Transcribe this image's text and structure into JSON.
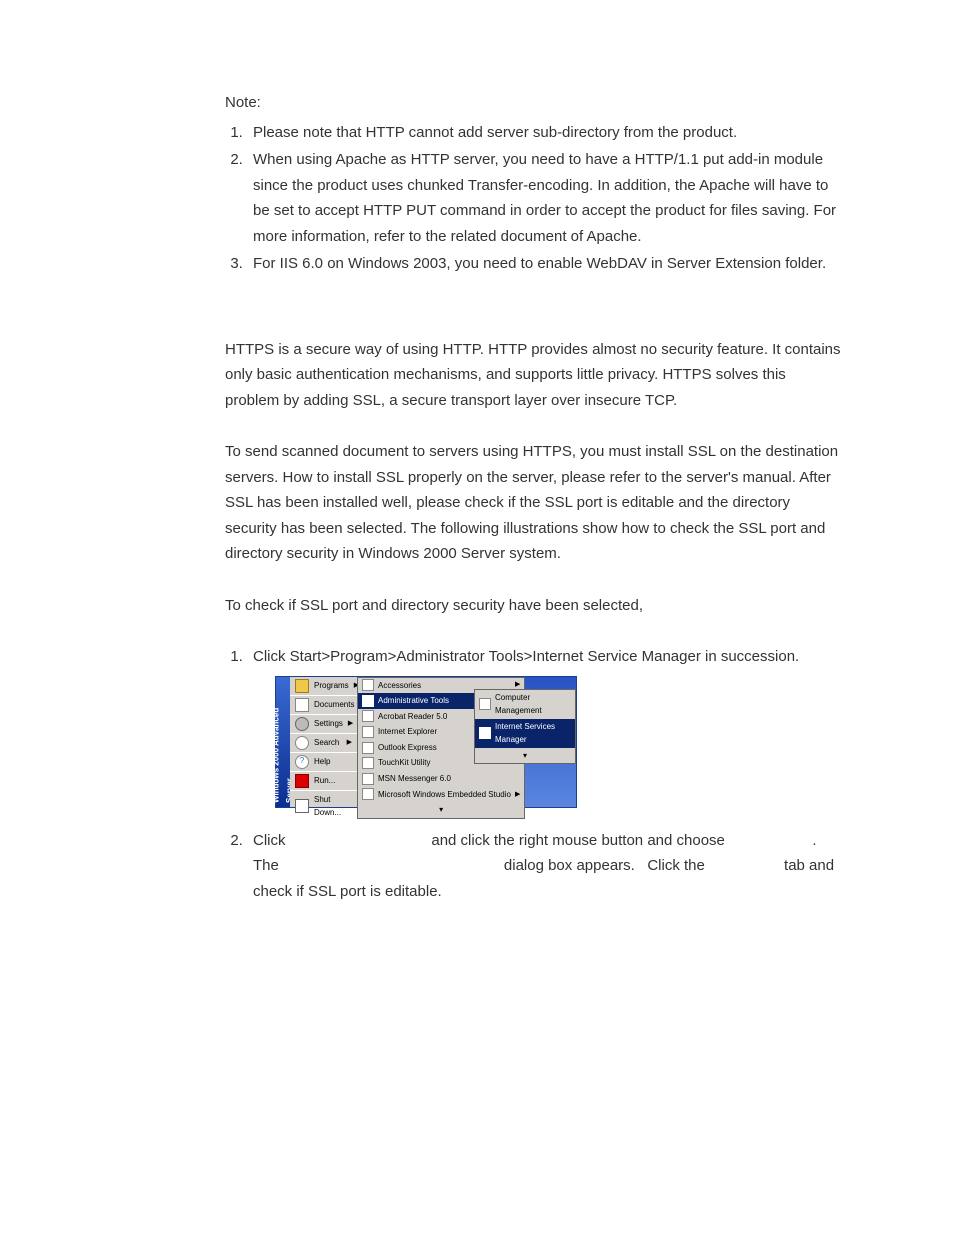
{
  "note": {
    "heading": "Note:",
    "items": [
      "Please note that HTTP cannot add server sub-directory from the product.",
      "When using Apache as HTTP server, you need to have a HTTP/1.1 put add-in module since the product uses chunked Transfer-encoding. In addition, the Apache will have to be set to accept HTTP PUT command in order to accept the product for files saving.   For more information, refer to the related document of Apache.",
      "For IIS 6.0 on Windows 2003, you need to enable WebDAV in Server Extension folder."
    ]
  },
  "para1": "HTTPS is a secure way of using HTTP.   HTTP provides almost no security feature. It contains only basic authentication mechanisms, and supports little privacy. HTTPS solves this problem by adding SSL, a secure transport layer over insecure TCP.",
  "para2": "To send scanned document to servers using HTTPS, you must install SSL on the destination servers.    How to install SSL properly on the server, please refer to the server's manual.    After SSL has been installed well, please check if the SSL port is editable and the directory security has been selected.   The following illustrations show how to check the SSL port and directory security in Windows 2000 Server system.",
  "para3": "To check if SSL port and directory security have been selected,",
  "steps": [
    "Click Start>Program>Administrator Tools>Internet Service Manager in succession.",
    "Click                                   and click the right mouse button and choose                     . The                                                      dialog box appears.   Click the                   tab and check if SSL port is editable."
  ],
  "startmenu": {
    "sidebar": "Windows 2000 Advanced Server",
    "main": [
      {
        "icon": "folder",
        "label": "Programs",
        "arrow": true
      },
      {
        "icon": "doc",
        "label": "Documents",
        "arrow": true
      },
      {
        "icon": "gear",
        "label": "Settings",
        "arrow": true
      },
      {
        "icon": "search",
        "label": "Search",
        "arrow": true
      },
      {
        "icon": "help",
        "label": "Help",
        "arrow": false
      },
      {
        "icon": "run",
        "label": "Run...",
        "arrow": false
      },
      {
        "icon": "shut",
        "label": "Shut Down...",
        "arrow": false
      }
    ],
    "sub1": [
      {
        "label": "Accessories",
        "hl": false,
        "arrow": true
      },
      {
        "label": "Administrative Tools",
        "hl": true,
        "arrow": true
      },
      {
        "label": "Acrobat Reader 5.0",
        "hl": false,
        "arrow": false
      },
      {
        "label": "Internet Explorer",
        "hl": false,
        "arrow": false
      },
      {
        "label": "Outlook Express",
        "hl": false,
        "arrow": false
      },
      {
        "label": "TouchKit Utility",
        "hl": false,
        "arrow": false
      },
      {
        "label": "MSN Messenger 6.0",
        "hl": false,
        "arrow": false
      },
      {
        "label": "Microsoft Windows Embedded Studio",
        "hl": false,
        "arrow": true
      },
      {
        "label": "▾",
        "hl": false,
        "arrow": false
      }
    ],
    "sub2": [
      {
        "label": "Computer Management",
        "hl": false
      },
      {
        "label": "Internet Services Manager",
        "hl": true
      },
      {
        "label": "▾",
        "hl": false
      }
    ]
  }
}
